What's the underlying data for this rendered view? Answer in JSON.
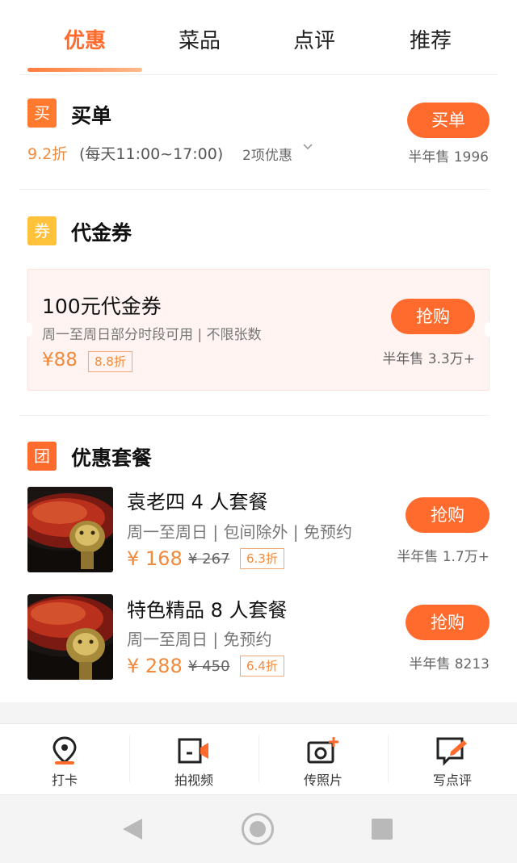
{
  "tabs": [
    "优惠",
    "菜品",
    "点评",
    "推荐"
  ],
  "buy": {
    "icon_char": "买",
    "title": "买单",
    "rate": "9.2折",
    "hours": "(每天11:00~17:00)",
    "promo": "2项优惠",
    "button": "买单",
    "sold": "半年售 1996"
  },
  "voucher_section": {
    "icon_char": "券",
    "title": "代金券",
    "card": {
      "title": "100元代金券",
      "desc": "周一至周日部分时段可用 | 不限张数",
      "price": "¥88",
      "discount": "8.8折",
      "button": "抢购",
      "sold": "半年售 3.3万+"
    }
  },
  "packages_section": {
    "icon_char": "团",
    "title": "优惠套餐",
    "items": [
      {
        "name": "袁老四 4 人套餐",
        "desc": "周一至周日 | 包间除外 | 免预约",
        "price": "¥ 168",
        "orig": "¥ 267",
        "discount": "6.3折",
        "button": "抢购",
        "sold": "半年售 1.7万+"
      },
      {
        "name": "特色精品 8 人套餐",
        "desc": "周一至周日 | 免预约",
        "price": "¥ 288",
        "orig": "¥ 450",
        "discount": "6.4折",
        "button": "抢购",
        "sold": "半年售 8213"
      }
    ]
  },
  "actions": [
    "打卡",
    "拍视频",
    "传照片",
    "写点评"
  ],
  "colors": {
    "accent": "#ff6a2d",
    "price": "#f08a3c",
    "buy_icon": "#ff7a2e",
    "voucher_icon": "#ffc23a",
    "package_icon": "#ff6a2d"
  },
  "icons": {
    "actions": [
      "location-pin-icon",
      "video-camera-icon",
      "photo-camera-icon",
      "write-review-icon"
    ],
    "system_nav": [
      "back-icon",
      "home-icon",
      "recent-apps-icon"
    ]
  }
}
